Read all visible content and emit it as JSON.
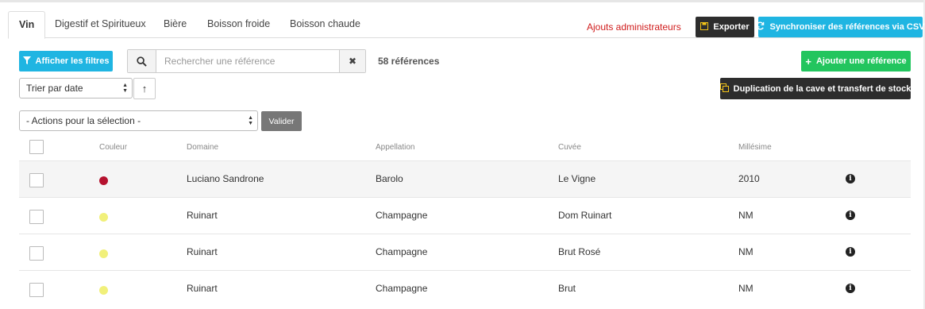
{
  "tabs": [
    {
      "label": "Vin",
      "active": true
    },
    {
      "label": "Digestif et Spiritueux",
      "active": false
    },
    {
      "label": "Bière",
      "active": false
    },
    {
      "label": "Boisson froide",
      "active": false
    },
    {
      "label": "Boisson chaude",
      "active": false
    }
  ],
  "header": {
    "admin_link": "Ajouts administrateurs",
    "export_label": "Exporter",
    "sync_label": "Synchroniser des références via CSV"
  },
  "toolbar": {
    "filters_label": "Afficher les filtres",
    "search_placeholder": "Rechercher une référence",
    "search_value": "",
    "count_label": "58 références",
    "add_label": "Ajouter une référence",
    "sort_value": "Trier par date",
    "duplicate_label": "Duplication de la cave et transfert de stock",
    "actions_value": "- Actions pour la sélection -",
    "validate_label": "Valider"
  },
  "colors": {
    "accent_cyan": "#1fb5e2",
    "green": "#22c55e",
    "dark": "#2d2d2d",
    "admin_red": "#d01c1c"
  },
  "table": {
    "columns": [
      "Couleur",
      "Domaine",
      "Appellation",
      "Cuvée",
      "Millésime"
    ],
    "rows": [
      {
        "color": "#b5122f",
        "domaine": "Luciano Sandrone",
        "appellation": "Barolo",
        "cuvee": "Le Vigne",
        "millesime": "2010"
      },
      {
        "color": "#f1f07a",
        "domaine": "Ruinart",
        "appellation": "Champagne",
        "cuvee": "Dom Ruinart",
        "millesime": "NM"
      },
      {
        "color": "#f1f07a",
        "domaine": "Ruinart",
        "appellation": "Champagne",
        "cuvee": "Brut Rosé",
        "millesime": "NM"
      },
      {
        "color": "#f1f07a",
        "domaine": "Ruinart",
        "appellation": "Champagne",
        "cuvee": "Brut",
        "millesime": "NM"
      }
    ]
  }
}
